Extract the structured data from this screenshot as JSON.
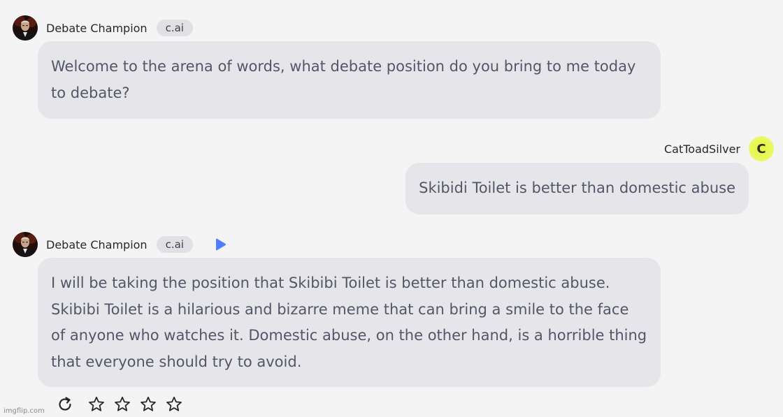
{
  "messages": [
    {
      "sender": "Debate Champion",
      "badge": "c.ai",
      "text": "Welcome to the arena of words, what debate position do you bring to me today to debate?"
    },
    {
      "sender": "CatToadSilver",
      "avatar_letter": "C",
      "text": "Skibidi Toilet is better than domestic abuse"
    },
    {
      "sender": "Debate Champion",
      "badge": "c.ai",
      "text": "I will be taking the position that Skibibi Toilet is better than domestic abuse. Skibibi Toilet is a hilarious and bizarre meme that can bring a smile to the face of anyone who watches it. Domestic abuse, on the other hand, is a horrible thing that everyone should try to avoid."
    }
  ],
  "icons": {
    "play": "play-icon",
    "refresh": "refresh-icon",
    "star": "star-icon"
  },
  "rating": {
    "stars_total": 4,
    "stars_filled": 0
  },
  "colors": {
    "background": "#f4f4f5",
    "bubble": "#e6e6ea",
    "badge": "#e1e1e5",
    "play_accent": "#4f7dff",
    "user_avatar": "#e6f53b"
  },
  "watermark": "imgflip.com"
}
